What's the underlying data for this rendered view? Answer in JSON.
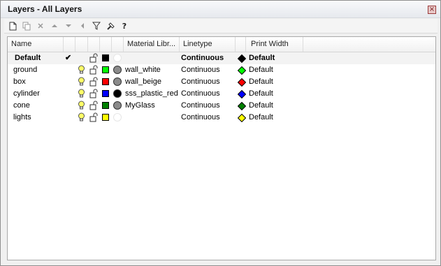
{
  "window": {
    "title": "Layers - All Layers",
    "close_icon": "close-icon"
  },
  "toolbar": {
    "buttons": [
      {
        "icon": "new-layer-icon"
      },
      {
        "icon": "copy-layer-icon"
      },
      {
        "icon": "delete-icon"
      },
      {
        "icon": "move-up-icon"
      },
      {
        "icon": "move-down-icon"
      },
      {
        "icon": "move-left-icon"
      },
      {
        "icon": "filter-icon"
      },
      {
        "icon": "tools-icon"
      },
      {
        "icon": "help-icon",
        "label": "?"
      }
    ]
  },
  "table": {
    "columns": [
      "Name",
      "",
      "",
      "",
      "",
      "",
      "Material Libr...",
      "Linetype",
      "",
      "Print Width"
    ],
    "rows": [
      {
        "name": "Default",
        "current": true,
        "current_mark": "✔",
        "visible": false,
        "locked": false,
        "color": "#000000",
        "material": "",
        "material_color": "",
        "linetype": "Continuous",
        "print_color": "#000000",
        "print_width": "Default",
        "bold": true,
        "selected": true
      },
      {
        "name": "ground",
        "current": false,
        "visible": true,
        "locked": false,
        "color": "#00ff00",
        "material": "wall_white",
        "material_color": "#8a8a8a",
        "linetype": "Continuous",
        "print_color": "#00ff00",
        "print_width": "Default"
      },
      {
        "name": "box",
        "current": false,
        "visible": true,
        "locked": false,
        "color": "#ff0000",
        "material": "wall_beige",
        "material_color": "#8a8a8a",
        "linetype": "Continuous",
        "print_color": "#ff0000",
        "print_width": "Default"
      },
      {
        "name": "cylinder",
        "current": false,
        "visible": true,
        "locked": false,
        "color": "#0000ff",
        "material": "sss_plastic_red",
        "material_color": "#000000",
        "linetype": "Continuous",
        "print_color": "#0000ff",
        "print_width": "Default"
      },
      {
        "name": "cone",
        "current": false,
        "visible": true,
        "locked": false,
        "color": "#008000",
        "material": "MyGlass",
        "material_color": "#8a8a8a",
        "linetype": "Continuous",
        "print_color": "#008000",
        "print_width": "Default"
      },
      {
        "name": "lights",
        "current": false,
        "visible": true,
        "locked": false,
        "color": "#ffff00",
        "material": "",
        "material_color": "",
        "linetype": "Continuous",
        "print_color": "#ffff00",
        "print_width": "Default"
      }
    ]
  }
}
